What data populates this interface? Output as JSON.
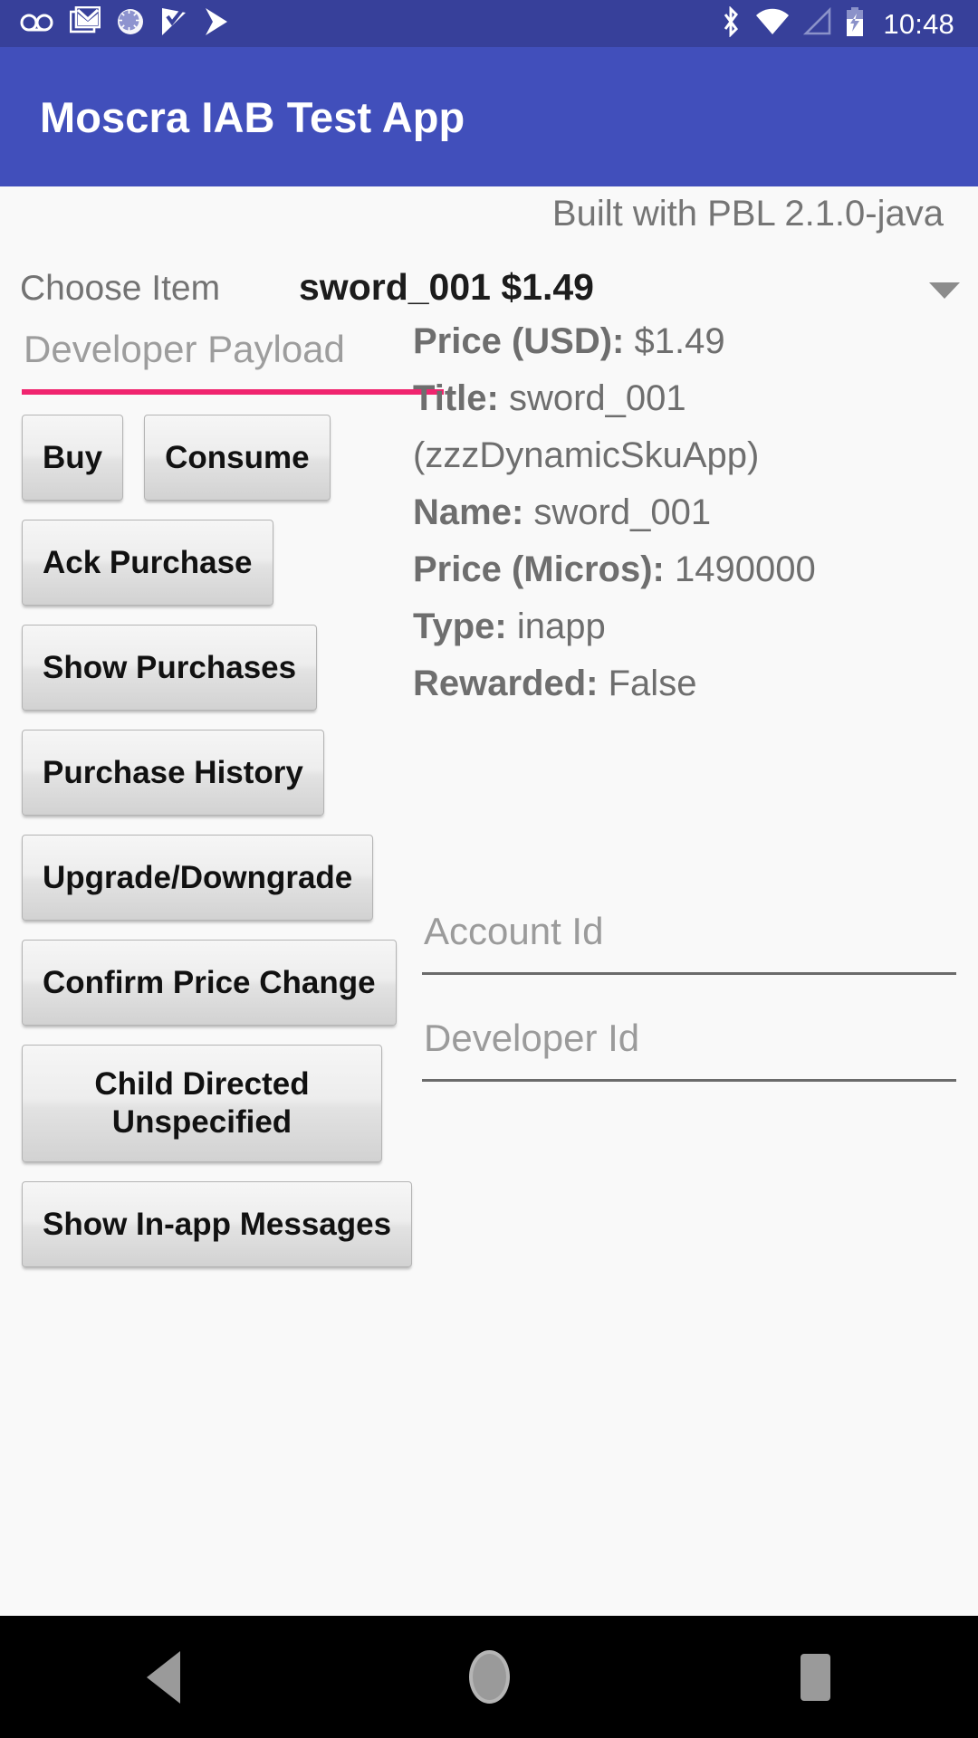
{
  "status_bar": {
    "time": "10:48",
    "notification_icons": [
      "voicemail-icon",
      "gmail-icon",
      "sync-circle-icon",
      "play-movies-icon",
      "play-store-icon"
    ],
    "system_icons": [
      "bluetooth-icon",
      "wifi-icon",
      "cell-signal-icon",
      "battery-charging-icon"
    ],
    "background_color": "#37409a"
  },
  "app_bar": {
    "title": "Moscra IAB Test App",
    "background_color": "#414fbb",
    "text_color": "#ffffff"
  },
  "content": {
    "built_with": "Built with PBL 2.1.0-java",
    "spinner": {
      "label": "Choose Item",
      "selected_value": "sword_001 $1.49",
      "caret_icon": "chevron-down-icon"
    },
    "payload_input": {
      "placeholder": "Developer Payload",
      "value": "",
      "underline_color": "#f0256f"
    },
    "buttons": [
      {
        "id": "buy",
        "label": "Buy"
      },
      {
        "id": "consume",
        "label": "Consume"
      },
      {
        "id": "ack-purchase",
        "label": "Ack Purchase"
      },
      {
        "id": "show-purchases",
        "label": "Show Purchases"
      },
      {
        "id": "purchase-history",
        "label": "Purchase History"
      },
      {
        "id": "upgrade-downgrade",
        "label": "Upgrade/Downgrade"
      },
      {
        "id": "confirm-price-change",
        "label": "Confirm Price Change"
      },
      {
        "id": "child-directed",
        "label": "Child Directed Unspecified"
      },
      {
        "id": "show-inapp-messages",
        "label": "Show In-app Messages"
      }
    ],
    "sku_details": [
      {
        "label": "Price (USD):",
        "value": "$1.49"
      },
      {
        "label": "Title:",
        "value": "sword_001 (zzzDynamicSkuApp)"
      },
      {
        "label": "Name:",
        "value": "sword_001"
      },
      {
        "label": "Price (Micros):",
        "value": "1490000"
      },
      {
        "label": "Type:",
        "value": "inapp"
      },
      {
        "label": "Rewarded:",
        "value": "False"
      }
    ],
    "id_fields": [
      {
        "id": "account-id",
        "placeholder": "Account Id",
        "value": ""
      },
      {
        "id": "developer-id",
        "placeholder": "Developer Id",
        "value": ""
      }
    ]
  },
  "nav_bar": {
    "background_color": "#000000",
    "buttons": [
      {
        "id": "back",
        "icon": "back-triangle-icon"
      },
      {
        "id": "home",
        "icon": "home-circle-icon"
      },
      {
        "id": "recents",
        "icon": "recents-square-icon"
      }
    ]
  }
}
